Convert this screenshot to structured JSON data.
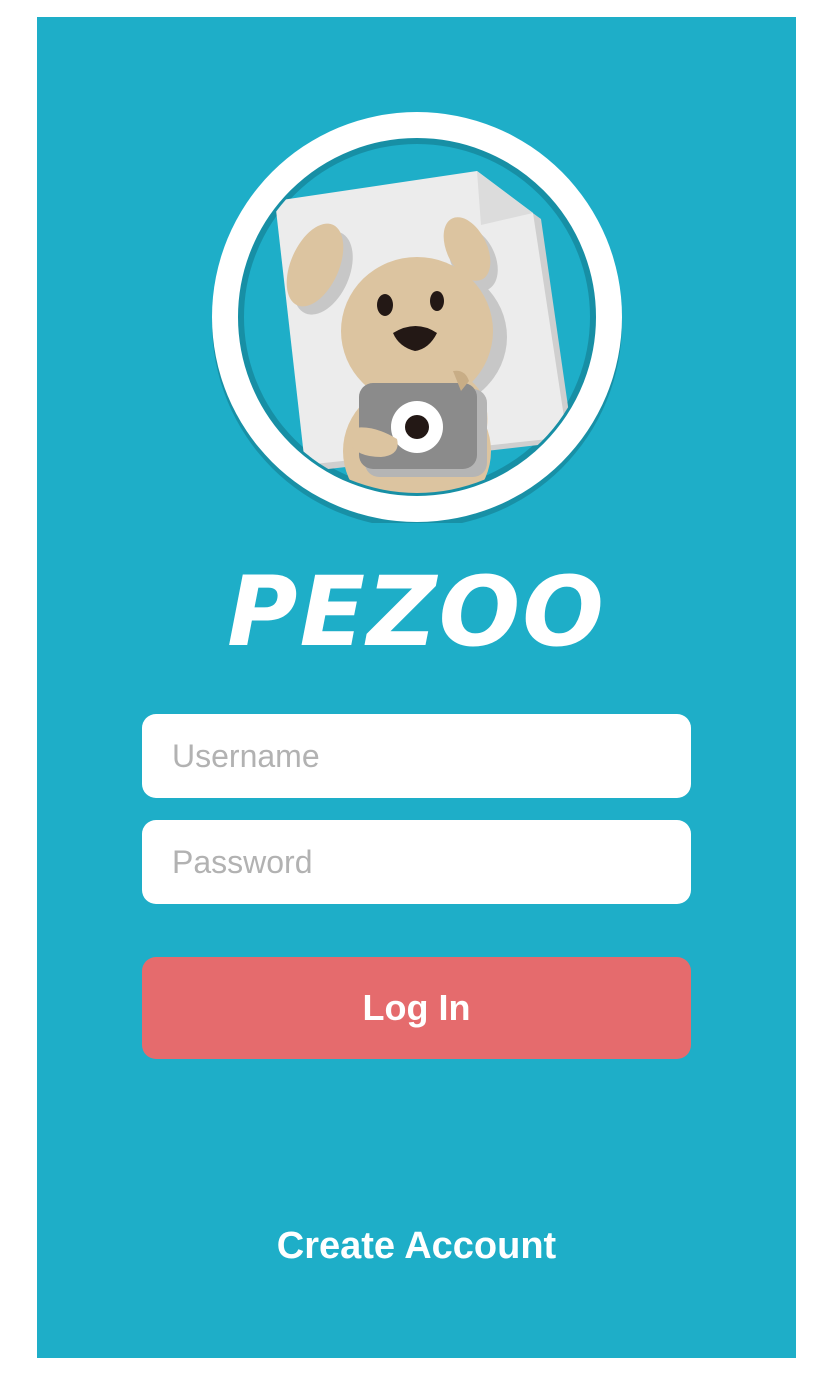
{
  "app": {
    "brand_name": "PEZOO",
    "logo_icon": "dog-with-camera-icon"
  },
  "login_form": {
    "username_placeholder": "Username",
    "password_placeholder": "Password",
    "login_label": "Log In",
    "create_account_label": "Create Account"
  },
  "colors": {
    "background": "#1eaec8",
    "login_button": "#e56b6d",
    "field_background": "#ffffff",
    "placeholder": "#b2b2b2"
  }
}
